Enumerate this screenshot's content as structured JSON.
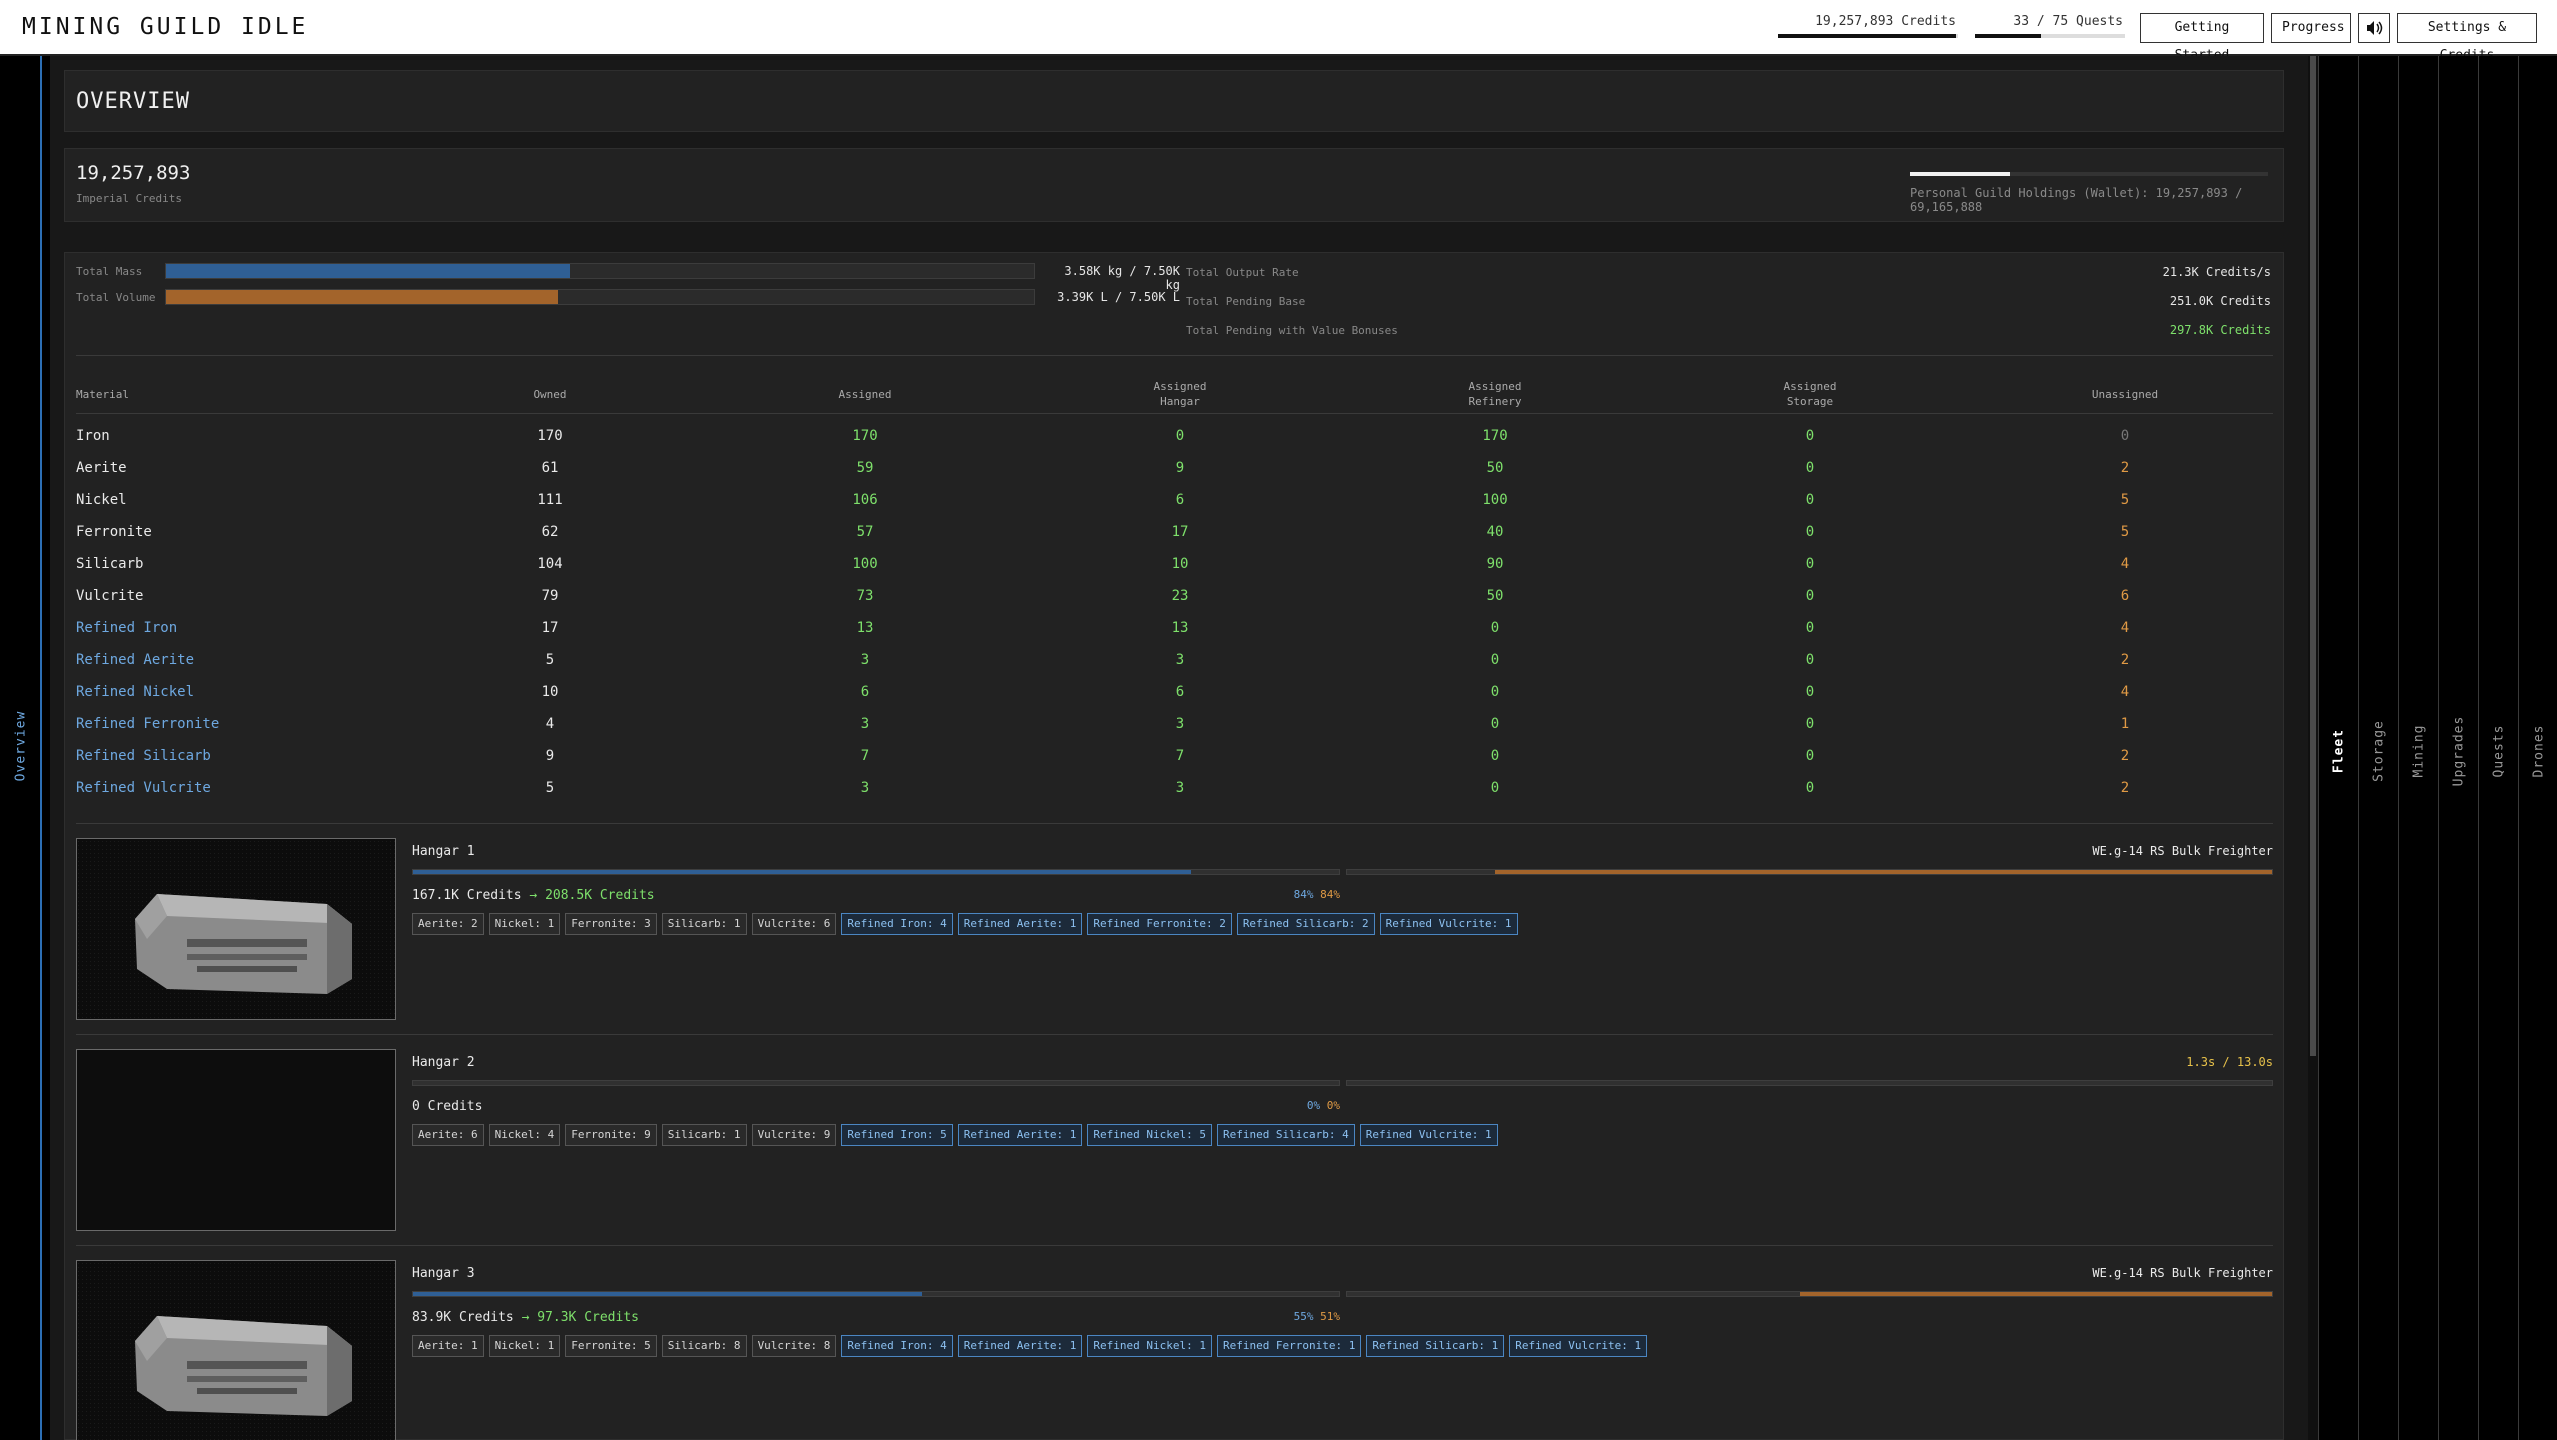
{
  "app": {
    "title": "MINING GUILD IDLE"
  },
  "top": {
    "credits_label": "19,257,893 Credits",
    "credits_fraction": 0.99,
    "quests_label": "33 / 75 Quests",
    "quests_fraction": 0.44,
    "buttons": {
      "getting_started": "Getting Started",
      "progress": "Progress",
      "sound_icon": "speaker-icon",
      "settings": "Settings & Credits"
    }
  },
  "left_tabs": {
    "overview": "Overview"
  },
  "right_tabs": {
    "fleet": "Fleet",
    "storage": "Storage",
    "mining": "Mining",
    "upgrades": "Upgrades",
    "quests": "Quests",
    "drones": "Drones"
  },
  "overview": {
    "title": "OVERVIEW"
  },
  "credits": {
    "value": "19,257,893",
    "label": "Imperial Credits",
    "holdings_text": "Personal Guild Holdings (Wallet): 19,257,893 / 69,165,888",
    "holdings_fraction": 0.28
  },
  "capacity": {
    "mass_label": "Total Mass",
    "mass_value": "3.58K kg / 7.50K kg",
    "mass_fraction": 0.466,
    "volume_label": "Total Volume",
    "volume_value": "3.39K L / 7.50K L",
    "volume_fraction": 0.452
  },
  "output": {
    "rate_label": "Total Output Rate",
    "rate_value": "21.3K Credits/s",
    "pending_label": "Total Pending Base",
    "pending_value": "251.0K Credits",
    "bonus_label": "Total Pending with Value Bonuses",
    "bonus_value": "297.8K Credits"
  },
  "table": {
    "headers": {
      "material": "Material",
      "owned": "Owned",
      "assigned": "Assigned",
      "hangar": "Assigned\nHangar",
      "refinery": "Assigned\nRefinery",
      "storage": "Assigned\nStorage",
      "unassigned": "Unassigned"
    },
    "rows": [
      {
        "material": "Iron",
        "owned": "170",
        "assigned": "170",
        "hangar": "0",
        "refinery": "170",
        "storage": "0",
        "unassigned": "0",
        "refined": false
      },
      {
        "material": "Aerite",
        "owned": "61",
        "assigned": "59",
        "hangar": "9",
        "refinery": "50",
        "storage": "0",
        "unassigned": "2",
        "refined": false
      },
      {
        "material": "Nickel",
        "owned": "111",
        "assigned": "106",
        "hangar": "6",
        "refinery": "100",
        "storage": "0",
        "unassigned": "5",
        "refined": false
      },
      {
        "material": "Ferronite",
        "owned": "62",
        "assigned": "57",
        "hangar": "17",
        "refinery": "40",
        "storage": "0",
        "unassigned": "5",
        "refined": false
      },
      {
        "material": "Silicarb",
        "owned": "104",
        "assigned": "100",
        "hangar": "10",
        "refinery": "90",
        "storage": "0",
        "unassigned": "4",
        "refined": false
      },
      {
        "material": "Vulcrite",
        "owned": "79",
        "assigned": "73",
        "hangar": "23",
        "refinery": "50",
        "storage": "0",
        "unassigned": "6",
        "refined": false
      },
      {
        "material": "Refined Iron",
        "owned": "17",
        "assigned": "13",
        "hangar": "13",
        "refinery": "0",
        "storage": "0",
        "unassigned": "4",
        "refined": true
      },
      {
        "material": "Refined Aerite",
        "owned": "5",
        "assigned": "3",
        "hangar": "3",
        "refinery": "0",
        "storage": "0",
        "unassigned": "2",
        "refined": true
      },
      {
        "material": "Refined Nickel",
        "owned": "10",
        "assigned": "6",
        "hangar": "6",
        "refinery": "0",
        "storage": "0",
        "unassigned": "4",
        "refined": true
      },
      {
        "material": "Refined Ferronite",
        "owned": "4",
        "assigned": "3",
        "hangar": "3",
        "refinery": "0",
        "storage": "0",
        "unassigned": "1",
        "refined": true
      },
      {
        "material": "Refined Silicarb",
        "owned": "9",
        "assigned": "7",
        "hangar": "7",
        "refinery": "0",
        "storage": "0",
        "unassigned": "2",
        "refined": true
      },
      {
        "material": "Refined Vulcrite",
        "owned": "5",
        "assigned": "3",
        "hangar": "3",
        "refinery": "0",
        "storage": "0",
        "unassigned": "2",
        "refined": true
      }
    ]
  },
  "hangars": [
    {
      "name": "Hangar 1",
      "ship": "WE.g-14 RS Bulk Freighter",
      "ship_is_timer": false,
      "has_ship": true,
      "credits": "167.1K Credits",
      "arrow": "→",
      "target": "208.5K Credits",
      "pct_a": "84%",
      "pct_b": "84%",
      "fill_a": 0.84,
      "fill_b": 0.84,
      "tags": [
        {
          "text": "Aerite: 2",
          "refined": false
        },
        {
          "text": "Nickel: 1",
          "refined": false
        },
        {
          "text": "Ferronite: 3",
          "refined": false
        },
        {
          "text": "Silicarb: 1",
          "refined": false
        },
        {
          "text": "Vulcrite: 6",
          "refined": false
        },
        {
          "text": "Refined Iron: 4",
          "refined": true
        },
        {
          "text": "Refined Aerite: 1",
          "refined": true
        },
        {
          "text": "Refined Ferronite: 2",
          "refined": true
        },
        {
          "text": "Refined Silicarb: 2",
          "refined": true
        },
        {
          "text": "Refined Vulcrite: 1",
          "refined": true
        }
      ]
    },
    {
      "name": "Hangar 2",
      "ship": "1.3s / 13.0s",
      "ship_is_timer": true,
      "has_ship": false,
      "credits": "0 Credits",
      "arrow": "",
      "target": "",
      "pct_a": "0%",
      "pct_b": "0%",
      "fill_a": 0,
      "fill_b": 0,
      "tags": [
        {
          "text": "Aerite: 6",
          "refined": false
        },
        {
          "text": "Nickel: 4",
          "refined": false
        },
        {
          "text": "Ferronite: 9",
          "refined": false
        },
        {
          "text": "Silicarb: 1",
          "refined": false
        },
        {
          "text": "Vulcrite: 9",
          "refined": false
        },
        {
          "text": "Refined Iron: 5",
          "refined": true
        },
        {
          "text": "Refined Aerite: 1",
          "refined": true
        },
        {
          "text": "Refined Nickel: 5",
          "refined": true
        },
        {
          "text": "Refined Silicarb: 4",
          "refined": true
        },
        {
          "text": "Refined Vulcrite: 1",
          "refined": true
        }
      ]
    },
    {
      "name": "Hangar 3",
      "ship": "WE.g-14 RS Bulk Freighter",
      "ship_is_timer": false,
      "has_ship": true,
      "credits": "83.9K Credits",
      "arrow": "→",
      "target": "97.3K Credits",
      "pct_a": "55%",
      "pct_b": "51%",
      "fill_a": 0.55,
      "fill_b": 0.51,
      "tags": [
        {
          "text": "Aerite: 1",
          "refined": false
        },
        {
          "text": "Nickel: 1",
          "refined": false
        },
        {
          "text": "Ferronite: 5",
          "refined": false
        },
        {
          "text": "Silicarb: 8",
          "refined": false
        },
        {
          "text": "Vulcrite: 8",
          "refined": false
        },
        {
          "text": "Refined Iron: 4",
          "refined": true
        },
        {
          "text": "Refined Aerite: 1",
          "refined": true
        },
        {
          "text": "Refined Nickel: 1",
          "refined": true
        },
        {
          "text": "Refined Ferronite: 1",
          "refined": true
        },
        {
          "text": "Refined Silicarb: 1",
          "refined": true
        },
        {
          "text": "Refined Vulcrite: 1",
          "refined": true
        }
      ]
    }
  ],
  "colors": {
    "accent_blue": "#2f5f95",
    "accent_orange": "#a3642b",
    "green": "#7ee06b",
    "orange": "#e09a45",
    "refined_blue": "#6ea8e0"
  }
}
